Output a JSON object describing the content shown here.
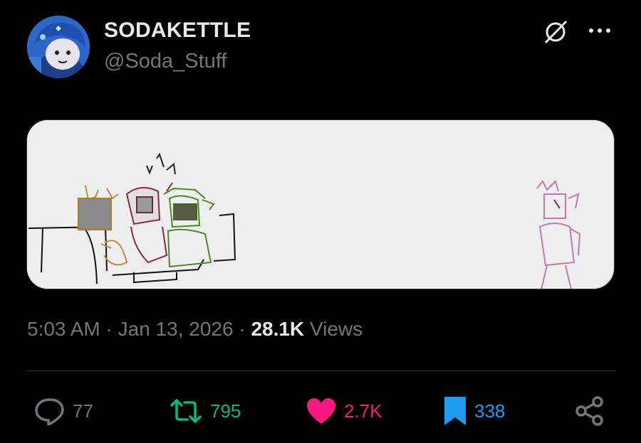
{
  "author": {
    "display_name": "SODAKETTLE",
    "handle": "@Soda_Stuff",
    "avatar_icon": "avatar-image"
  },
  "header_icons": [
    "grok-icon",
    "more-options-icon"
  ],
  "media": {
    "type": "sketch-illustration"
  },
  "meta": {
    "time": "5:03 AM",
    "sep1": " · ",
    "date": "Jan 13, 2026",
    "sep2": " · ",
    "views_count": "28.1K",
    "views_label": " Views"
  },
  "actions": {
    "replies": "77",
    "reposts": "795",
    "likes": "2.7K",
    "bookmarks": "338"
  },
  "colors": {
    "background": "#000000",
    "text_primary": "#e7e9ea",
    "text_secondary": "#71767b",
    "repost": "#00ba7c",
    "like": "#f91880",
    "bookmark": "#1d9bf0"
  }
}
